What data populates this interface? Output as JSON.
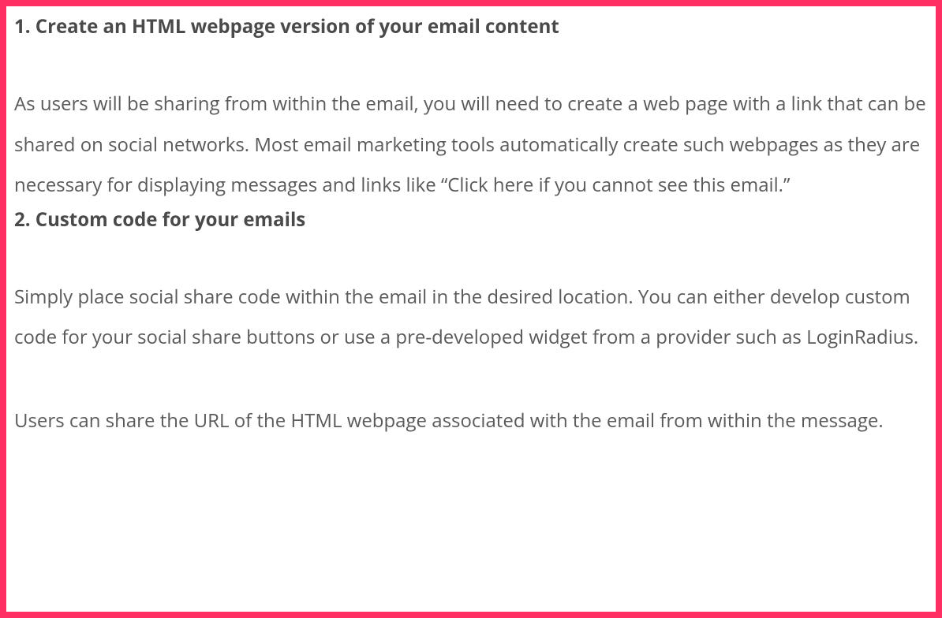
{
  "sections": [
    {
      "heading": "1. Create an HTML webpage version of your email content",
      "paragraphs": [
        "As users will be sharing from within the email, you will need to create a web page with a link that can be shared on social networks. Most email marketing tools automatically create such webpages as they are necessary for displaying messages and links like “Click here if you cannot see this email.”"
      ]
    },
    {
      "heading": "2. Custom code for your emails",
      "paragraphs": [
        "Simply place social share code within the email in the desired location. You can either develop custom code for your social share buttons or use a pre-developed widget from a provider such as LoginRadius.",
        "Users can share the URL of the HTML webpage associated with the email from within the message."
      ]
    }
  ]
}
